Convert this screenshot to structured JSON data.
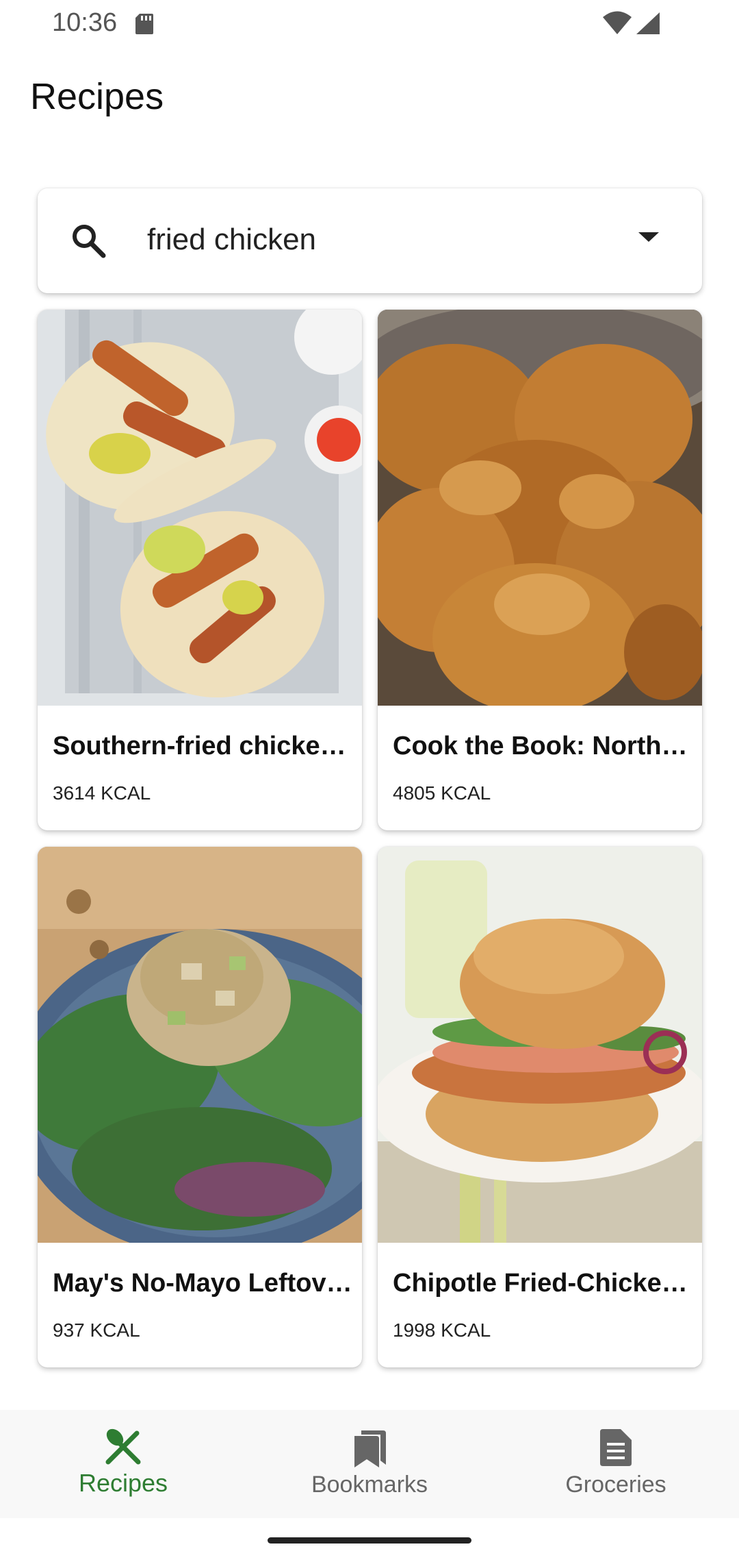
{
  "status_bar": {
    "time": "10:36"
  },
  "header": {
    "title": "Recipes"
  },
  "search": {
    "value": "fried chicken"
  },
  "recipes": [
    {
      "title": "Southern-fried chicke…",
      "kcal": "3614 KCAL",
      "image": "chicken-tacos-photo"
    },
    {
      "title": "Cook the Book: Northe…",
      "kcal": "4805 KCAL",
      "image": "fried-chicken-photo"
    },
    {
      "title": "May's No-Mayo Leftov…",
      "kcal": "937 KCAL",
      "image": "chicken-salad-photo"
    },
    {
      "title": "Chipotle Fried-Chicke…",
      "kcal": "1998 KCAL",
      "image": "chicken-sandwich-photo"
    }
  ],
  "bottom_nav": {
    "items": [
      {
        "label": "Recipes",
        "icon": "fork-knife-icon",
        "active": true
      },
      {
        "label": "Bookmarks",
        "icon": "bookmarks-icon",
        "active": false
      },
      {
        "label": "Groceries",
        "icon": "list-icon",
        "active": false
      }
    ]
  },
  "colors": {
    "accent": "#2e7d32",
    "inactive": "#666666"
  }
}
